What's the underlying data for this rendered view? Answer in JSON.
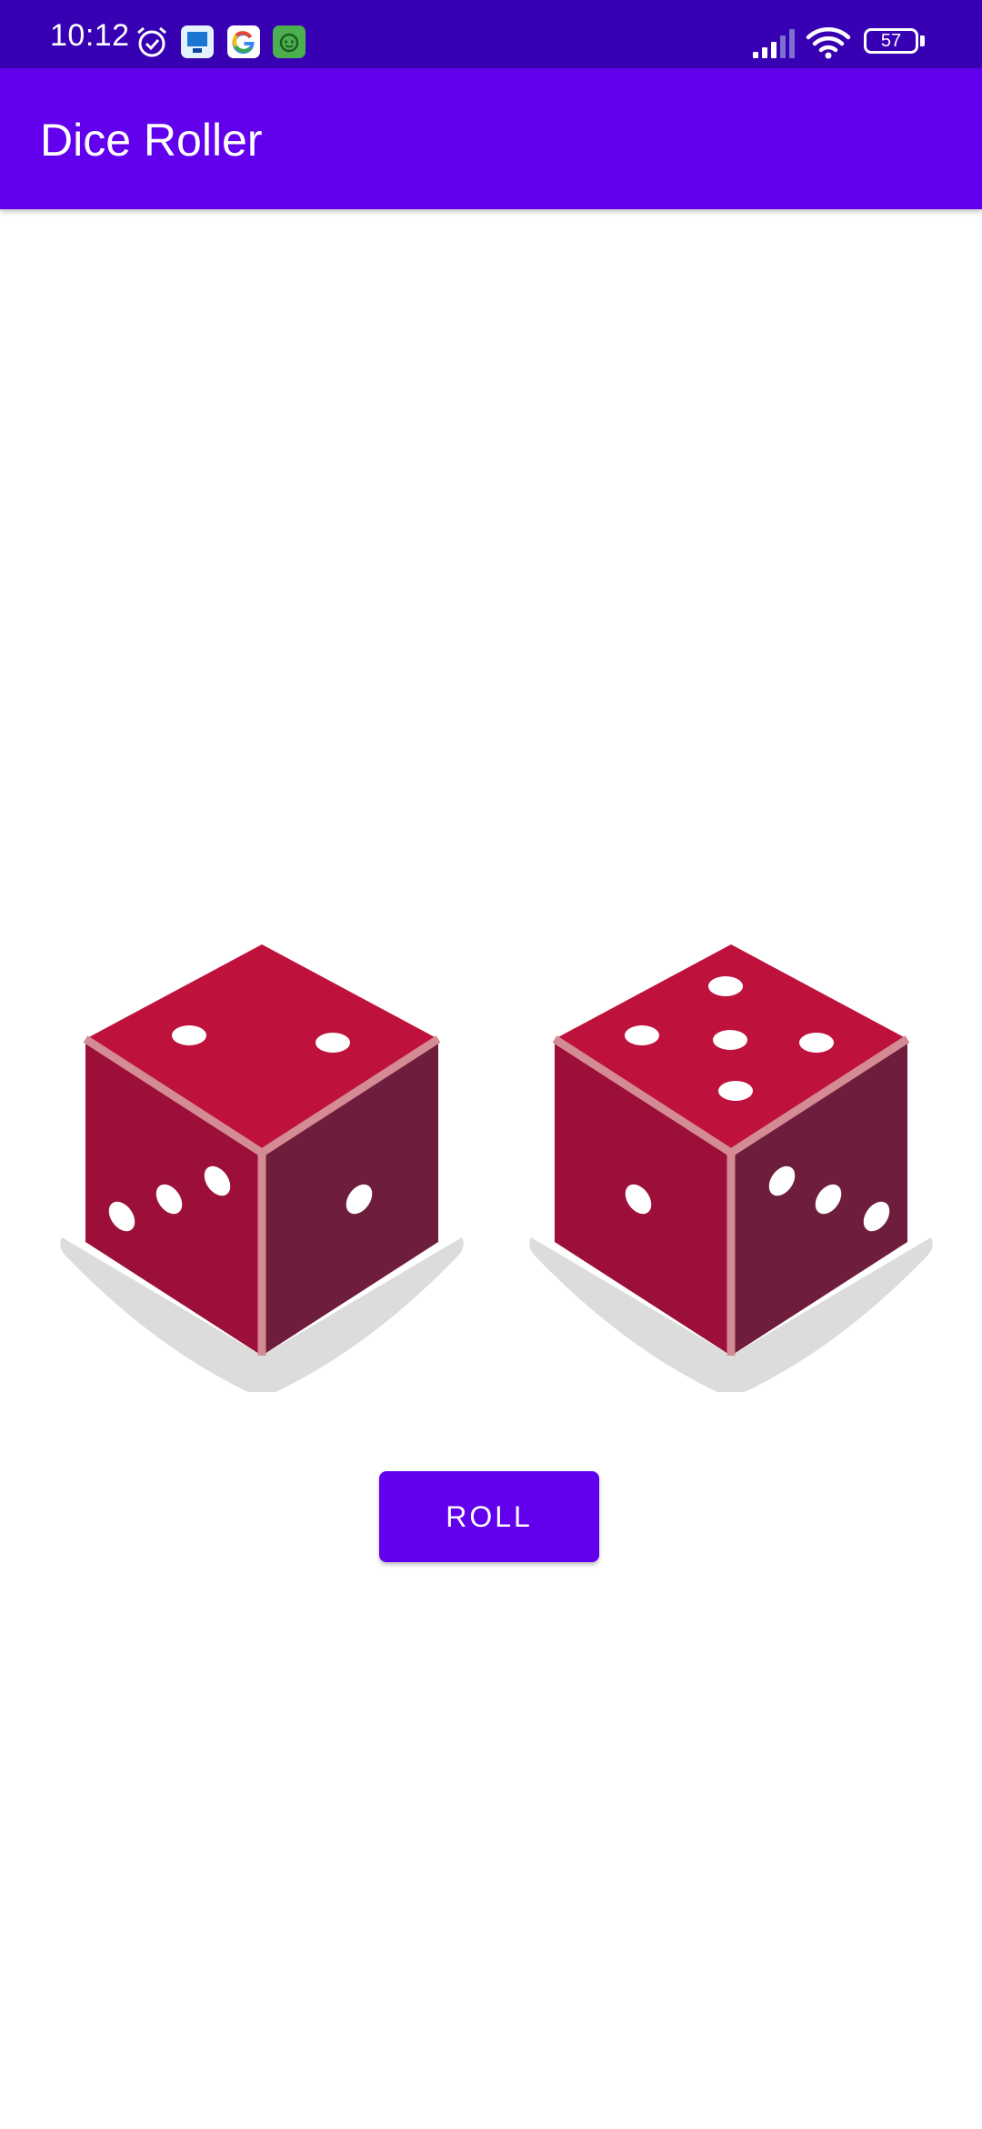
{
  "status_bar": {
    "time": "10:12",
    "battery": "57",
    "icons": [
      "alarm-icon",
      "notification-app-icon",
      "google-icon",
      "android-app-icon",
      "signal-icon",
      "wifi-icon",
      "battery-icon"
    ],
    "background_color": "#3700b3"
  },
  "app_bar": {
    "title": "Dice Roller",
    "background_color": "#6200ee"
  },
  "dice": [
    {
      "top_face": 2,
      "left_face": 3,
      "right_face": 1
    },
    {
      "top_face": 5,
      "left_face": 1,
      "right_face": 3
    }
  ],
  "colors": {
    "die_top": "#be123c",
    "die_left": "#9b0f38",
    "die_right": "#6e1d3c",
    "die_edge": "#d48b94",
    "pip": "#ffffff",
    "shadow": "#dcdcdc"
  },
  "roll_button": {
    "label": "ROLL",
    "background_color": "#6200ee"
  }
}
